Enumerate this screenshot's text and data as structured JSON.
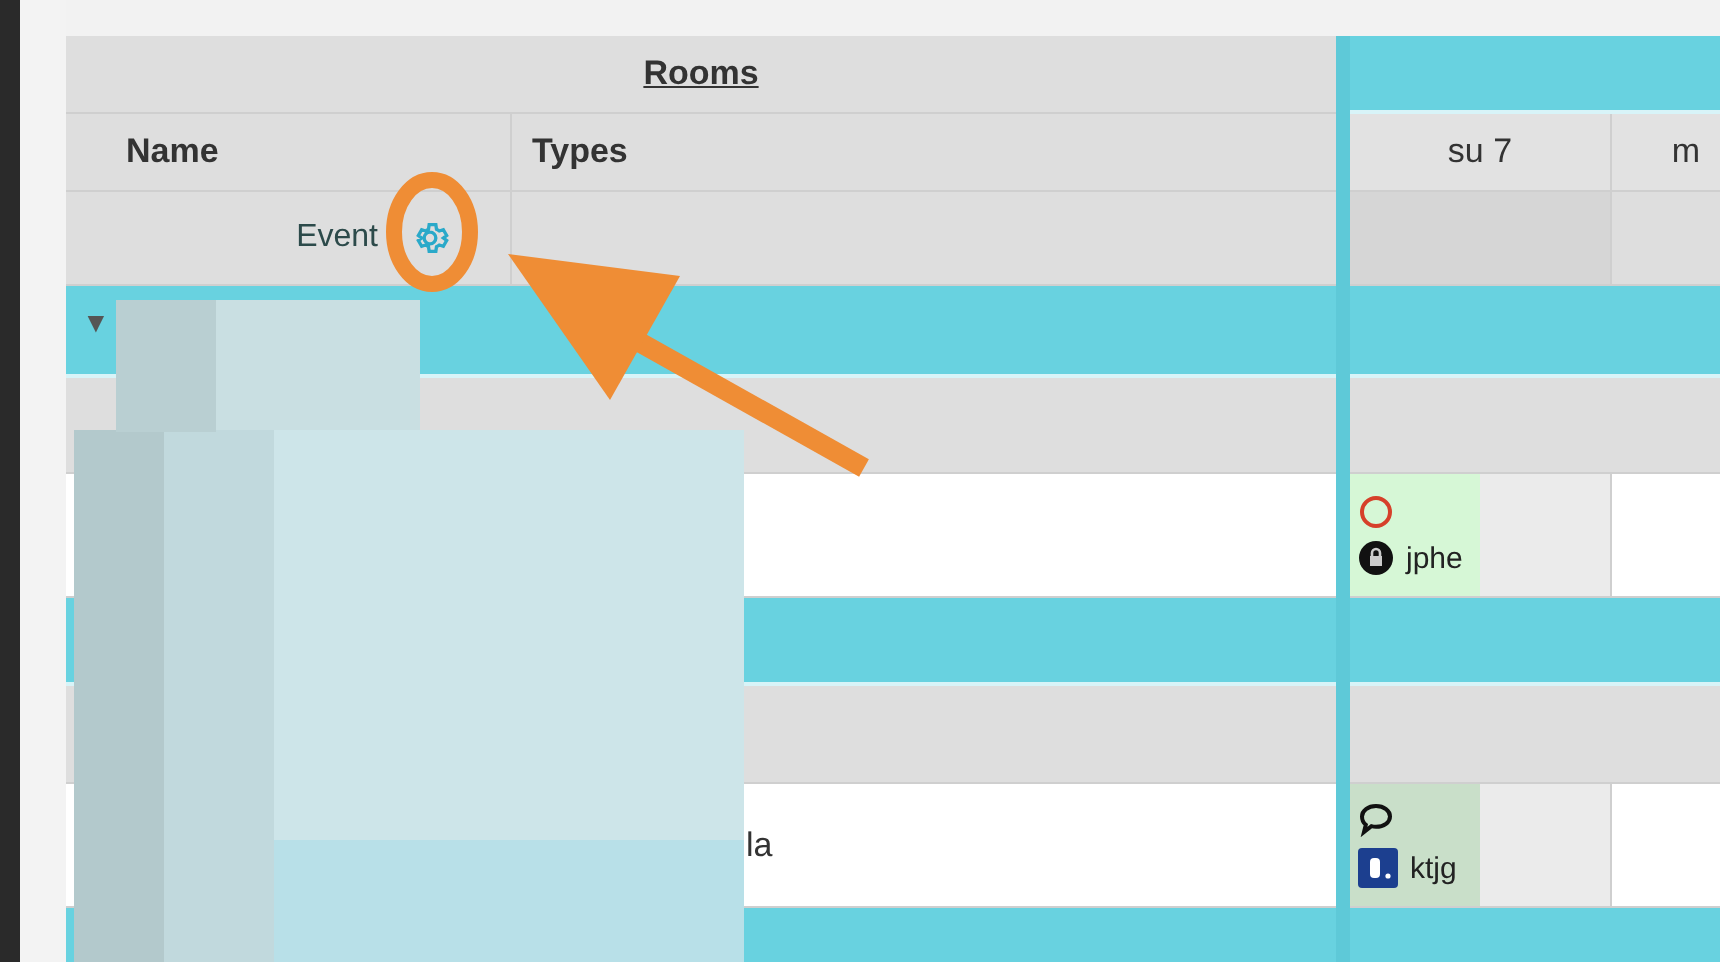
{
  "header": {
    "title": "Rooms"
  },
  "columns": [
    {
      "label": "Name"
    },
    {
      "label": "Types"
    }
  ],
  "days": [
    {
      "label": "su 7"
    },
    {
      "label": "m"
    }
  ],
  "filter_row": {
    "label": "Event"
  },
  "rows": [
    {
      "kind": "group",
      "toggle": "▼"
    },
    {
      "kind": "subgroup"
    },
    {
      "kind": "room",
      "bookings": [
        {
          "kind": "ring",
          "user": "jphe",
          "color": "#d6f7d6"
        }
      ]
    },
    {
      "kind": "group"
    },
    {
      "kind": "subgroup"
    },
    {
      "kind": "room",
      "name": "la",
      "bookings": [
        {
          "kind": "bubble",
          "user": "ktjg",
          "color": "#c9dfc9"
        }
      ]
    },
    {
      "kind": "group"
    }
  ]
}
